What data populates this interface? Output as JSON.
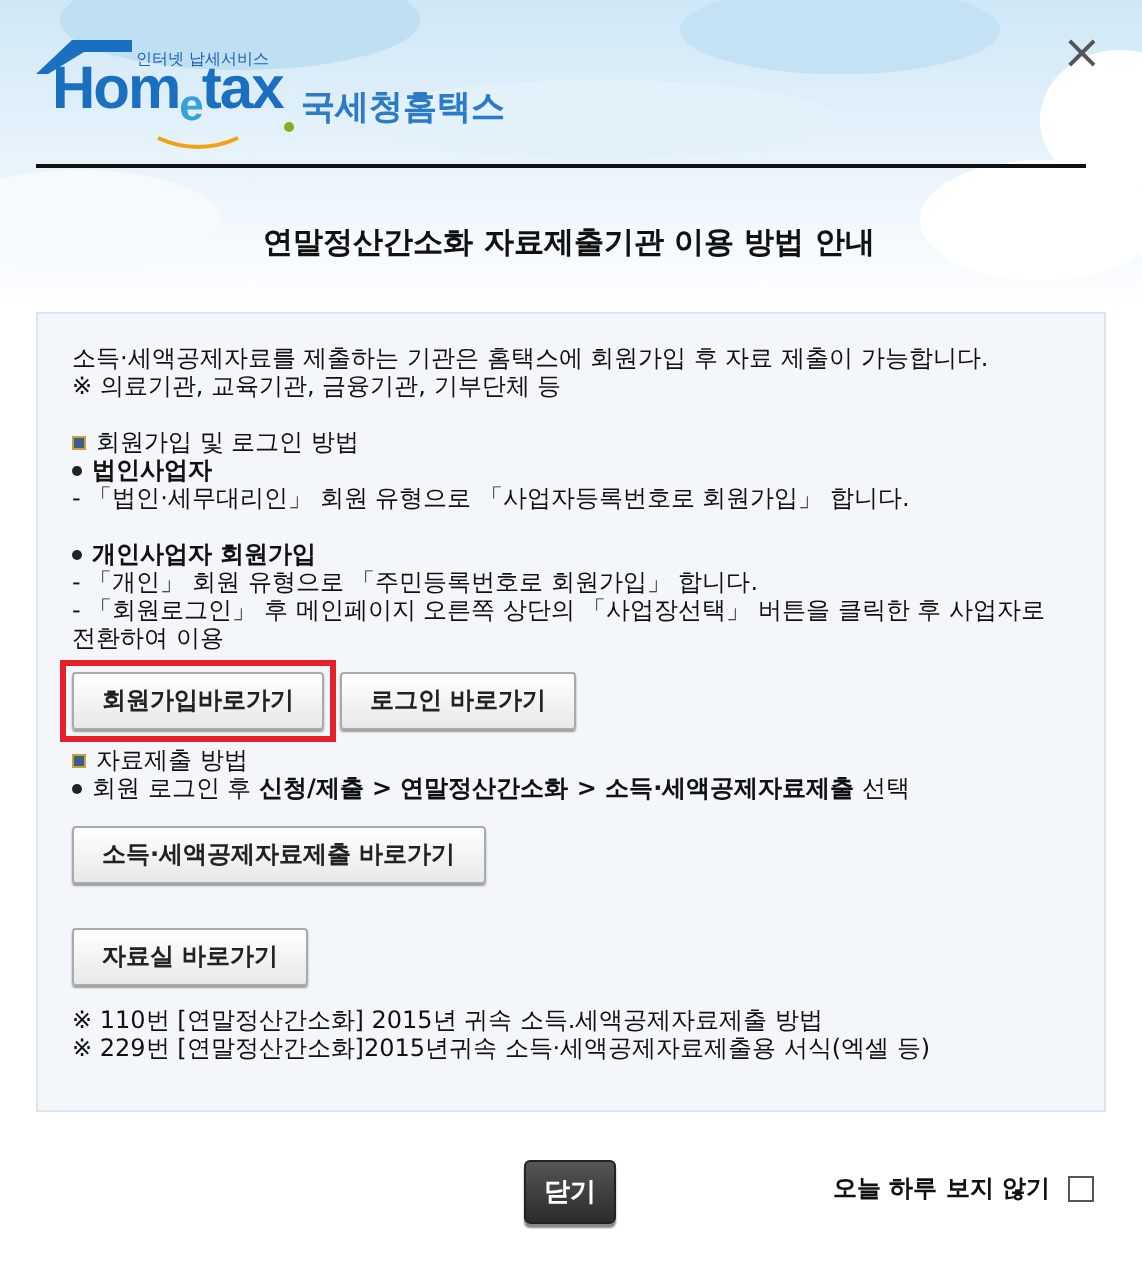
{
  "header": {
    "logo": {
      "tagline": "인터넷 납세서비스",
      "wordmark": "Hom$_{e}$tax",
      "name": "국세청홈택스"
    },
    "close": "×"
  },
  "title": "연말정산간소화 자료제출기관 이용 방법 안내",
  "blocks": [
    {
      "kind": "text",
      "text": "소득·세액공제자료를 제출하는 기관은 홈택스에 회원가입 후 자료 제출이 가능합니다."
    },
    {
      "kind": "text",
      "text": "※ 의료기관, 교육기관, 금융기관, 기부단체 등"
    },
    {
      "kind": "gap"
    },
    {
      "kind": "section",
      "text": "회원가입 및 로그인 방법"
    },
    {
      "kind": "heading",
      "text": "법인사업자"
    },
    {
      "kind": "text",
      "text": "- 「법인·세무대리인」 회원 유형으로 「사업자등록번호로 회원가입」 합니다."
    },
    {
      "kind": "gap"
    },
    {
      "kind": "heading",
      "text": "개인사업자 회원가입"
    },
    {
      "kind": "text",
      "text": "- 「개인」 회원 유형으로 「주민등록번호로 회원가입」 합니다."
    },
    {
      "kind": "text",
      "text": "- 「회원로그인」 후 메인페이지 오른쪽 상단의 「사업장선택」 버튼을 클릭한 후 사업자로 전환하여 이용"
    },
    {
      "kind": "buttons",
      "buttons": [
        {
          "label": "회원가입바로가기",
          "highlighted": true
        },
        {
          "label": "로그인 바로가기",
          "highlighted": false
        }
      ]
    },
    {
      "kind": "section",
      "text": "자료제출 방법"
    },
    {
      "kind": "bullet",
      "text": "회원 로그인 후 **신청/제출 > 연말정산간소화 > 소득·세액공제자료제출** 선택"
    },
    {
      "kind": "buttons",
      "buttons": [
        {
          "label": "소득·세액공제자료제출 바로가기",
          "highlighted": false
        }
      ]
    },
    {
      "kind": "buttons",
      "buttons": [
        {
          "label": "자료실 바로가기",
          "highlighted": false
        }
      ]
    },
    {
      "kind": "text",
      "text": "※ 110번 [연말정산간소화] 2015년 귀속 소득.세액공제자료제출 방법"
    },
    {
      "kind": "text",
      "text": "※ 229번 [연말정산간소화]2015년귀속 소득·세액공제자료제출용 서식(엑셀 등)"
    }
  ],
  "footer": {
    "close_button": "닫기",
    "dont_show_today": {
      "label": "오늘 하루 보지 않기",
      "checked": false
    }
  }
}
